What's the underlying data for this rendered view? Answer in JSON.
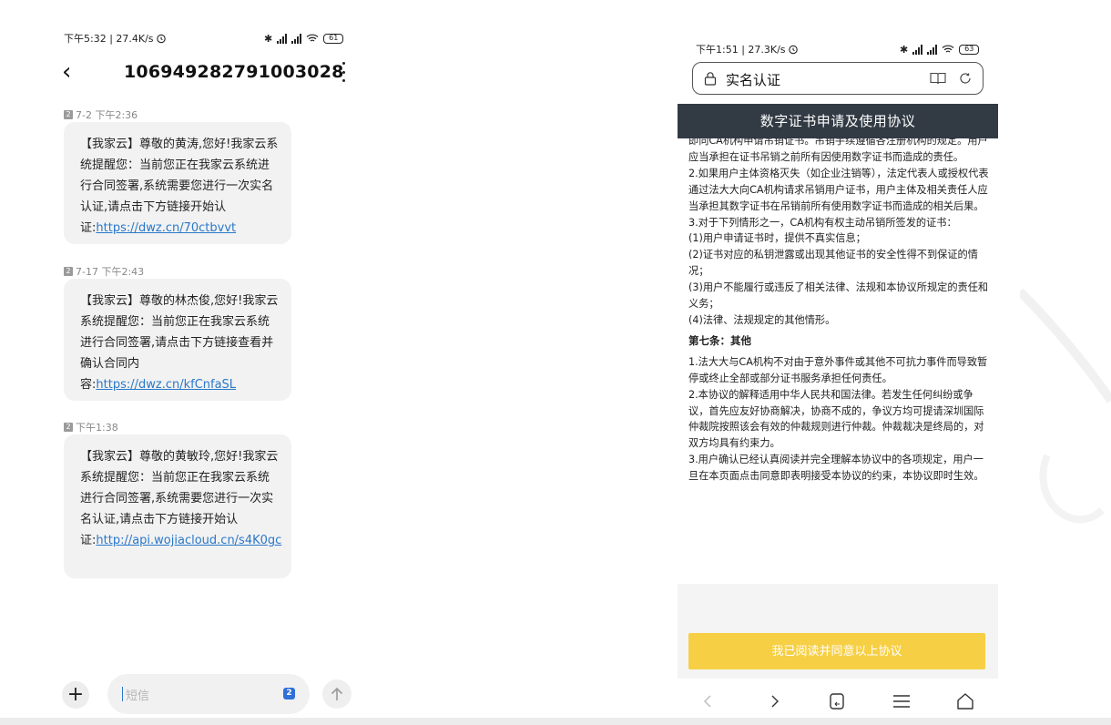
{
  "left_phone": {
    "status_bar": {
      "left": "下午5:32 | 27.4K/s",
      "battery": "61"
    },
    "header": {
      "title": "106949282791003028"
    },
    "messages": [
      {
        "stamp": "7-2 下午2:36",
        "text": "【我家云】尊敬的黄涛,您好!我家云系统提醒您：当前您正在我家云系统进行合同签署,系统需要您进行一次实名认证,请点击下方链接开始认证:",
        "link": "https://dwz.cn/70ctbvvt"
      },
      {
        "stamp": "7-17 下午2:43",
        "text": "【我家云】尊敬的林杰俊,您好!我家云系统提醒您：当前您正在我家云系统进行合同签署,请点击下方链接查看并确认合同内容:",
        "link": "https://dwz.cn/kfCnfaSL"
      },
      {
        "stamp": "下午1:38",
        "text": "【我家云】尊敬的黄敏玲,您好!我家云系统提醒您：当前您正在我家云系统进行合同签署,系统需要您进行一次实名认证,请点击下方链接开始认证:",
        "link": "http://api.wojiacloud.cn/s4K0gc"
      }
    ],
    "composer": {
      "placeholder": "短信",
      "sim": "2"
    },
    "sim_badge": "2"
  },
  "right_phone": {
    "status_bar": {
      "left": "下午1:51 | 27.3K/s",
      "battery": "63"
    },
    "address_bar": {
      "title": "实名认证"
    },
    "doc_title": "数字证书申请及使用协议",
    "paragraphs_top": [
      "即向CA机构申请吊销证书。吊销手续遵循各注册机构的规定。用户应当承担在证书吊销之前所有因使用数字证书而造成的责任。",
      "2.如果用户主体资格灭失（如企业注销等），法定代表人或授权代表通过法大大向CA机构请求吊销用户证书，用户主体及相关责任人应当承担其数字证书在吊销前所有使用数字证书而造成的相关后果。",
      "3.对于下列情形之一，CA机构有权主动吊销所签发的证书：",
      "(1)用户申请证书时，提供不真实信息；",
      "(2)证书对应的私钥泄露或出现其他证书的安全性得不到保证的情况；",
      "(3)用户不能履行或违反了相关法律、法规和本协议所规定的责任和义务；",
      "(4)法律、法规规定的其他情形。"
    ],
    "section_title": "第七条：其他",
    "paragraphs_bottom": [
      "1.法大大与CA机构不对由于意外事件或其他不可抗力事件而导致暂停或终止全部或部分证书服务承担任何责任。",
      "2.本协议的解释适用中华人民共和国法律。若发生任何纠纷或争议，首先应友好协商解决，协商不成的，争议方均可提请深圳国际仲裁院按照该会有效的仲裁规则进行仲裁。仲裁裁决是终局的，对双方均具有约束力。",
      "3.用户确认已经认真阅读并完全理解本协议中的各项规定，用户一旦在本页面点击同意即表明接受本协议的约束，本协议即时生效。"
    ],
    "agree_button": "我已阅读并同意以上协议"
  },
  "icons": {
    "back": "chevron-left-icon",
    "more": "more-vertical-icon",
    "plus": "plus-icon",
    "send": "arrow-up-icon",
    "lock": "lock-icon",
    "reader": "book-icon",
    "reload": "reload-icon",
    "nav_back": "chevron-left-icon",
    "nav_forward": "chevron-right-icon",
    "tabs": "tabs-icon",
    "menu": "menu-icon",
    "home": "home-icon"
  },
  "colors": {
    "link": "#2a78c9",
    "bubble": "#f2f2f2",
    "doc_header": "#323a44",
    "agree_button": "#f6cf45",
    "sim_badge": "#2f6fd8"
  }
}
